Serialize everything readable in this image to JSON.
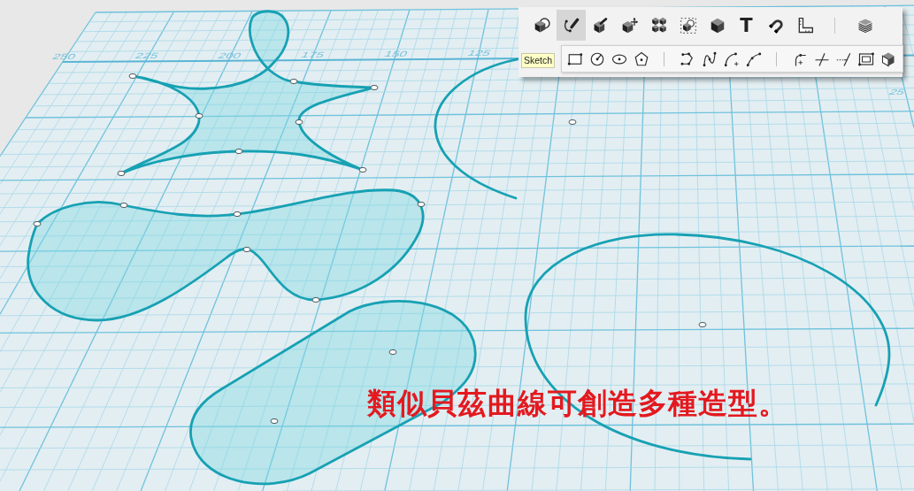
{
  "toolbar": {
    "main_tools": [
      {
        "selected": false
      },
      {
        "selected": true
      },
      {
        "selected": false
      },
      {
        "selected": false
      },
      {
        "selected": false
      },
      {
        "selected": false
      },
      {
        "selected": false
      },
      {
        "glyph": "T",
        "selected": false
      },
      {
        "selected": false
      },
      {
        "selected": false
      },
      {
        "selected": false
      }
    ],
    "tooltip": "Sketch"
  },
  "grid": {
    "x_axis_labels": [
      "250",
      "225",
      "200",
      "175",
      "150",
      "125"
    ],
    "y_axis_labels": [
      "25"
    ]
  },
  "caption": "類似貝茲曲線可創造多種造型。"
}
